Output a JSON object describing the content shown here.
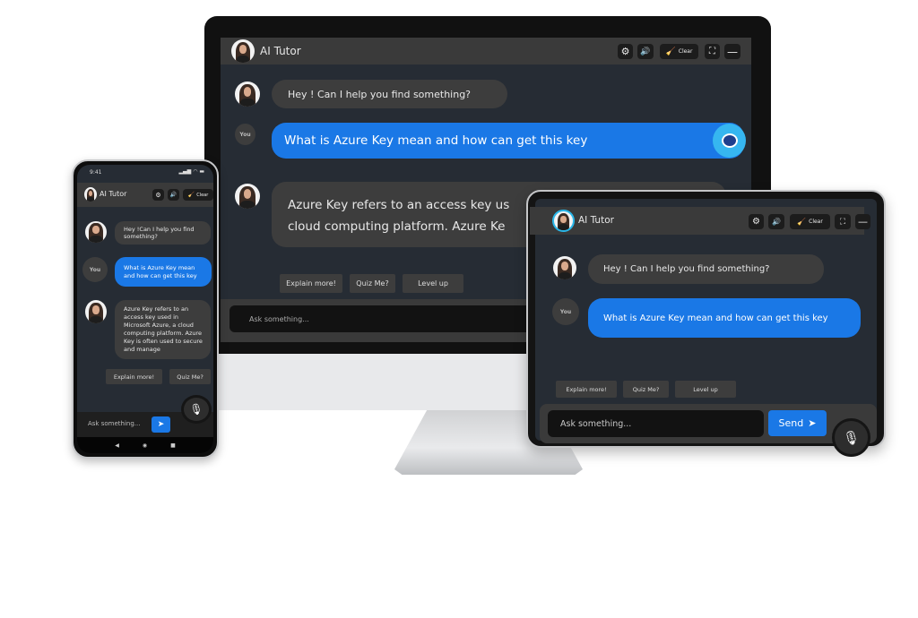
{
  "colors": {
    "accent": "#1a78e6",
    "header": "#3a3a3a",
    "background": "#262c34",
    "bubble": "#3d3d3d"
  },
  "monitor": {
    "title": "AI Tutor",
    "clear_label": "Clear",
    "icons": [
      "gear-icon",
      "speaker-icon",
      "broom-icon",
      "expand-icon",
      "minimize-icon",
      "robot-icon"
    ],
    "messages": [
      {
        "from": "bot",
        "text": "Hey ! Can I help you find something?"
      },
      {
        "from": "user",
        "avatar_label": "You",
        "text": "What is Azure Key mean and how can get this key"
      },
      {
        "from": "bot",
        "lines": [
          "Azure Key refers to an access key us",
          "cloud computing platform. Azure Ke"
        ]
      }
    ],
    "suggestions": [
      "Explain more!",
      "Quiz Me?",
      "Level up"
    ],
    "input_placeholder": "Ask something..."
  },
  "phone": {
    "time": "9:41",
    "title": "AI Tutor",
    "clear_label": "Clear",
    "messages": [
      {
        "from": "bot",
        "text": "Hey !Can I help you find something?"
      },
      {
        "from": "user",
        "avatar_label": "You",
        "text": "What is Azure Key mean and how can get this key"
      },
      {
        "from": "bot",
        "text": "Azure Key refers to an access key used in Microsoft Azure, a cloud computing platform. Azure Key is often used to secure and manage"
      }
    ],
    "suggestions": [
      "Explain more!",
      "Quiz Me?"
    ],
    "input_placeholder": "Ask something...",
    "nav": [
      "◀",
      "◉",
      "■"
    ]
  },
  "tablet": {
    "title": "AI Tutor",
    "clear_label": "Clear",
    "messages": [
      {
        "from": "bot",
        "text": "Hey ! Can I help you find something?"
      },
      {
        "from": "user",
        "avatar_label": "You",
        "text": "What is Azure Key mean and how can get this key"
      }
    ],
    "suggestions": [
      "Explain more!",
      "Quiz Me?",
      "Level up"
    ],
    "input_placeholder": "Ask something...",
    "send_label": "Send"
  }
}
